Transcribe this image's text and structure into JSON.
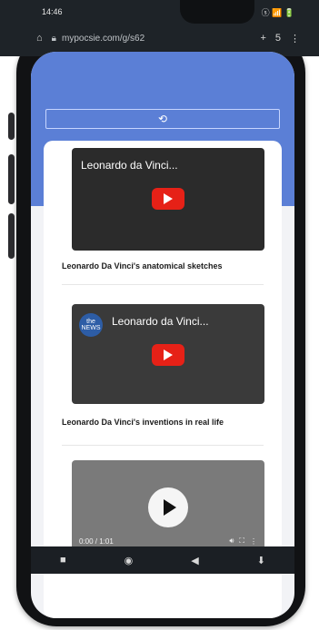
{
  "status": {
    "time": "14:46",
    "left_icons": "ⓔ ⓘ",
    "right_icons": "ⓢ 📶 🔋"
  },
  "browser": {
    "url": "mypocsie.com/g/s62",
    "tabs_count": "5"
  },
  "videos": [
    {
      "title": "Leonardo da Vinci...",
      "caption": "Leonardo Da Vinci's anatomical sketches"
    },
    {
      "title": "Leonardo da Vinci...",
      "caption": "Leonardo Da Vinci's inventions in real life",
      "channel_badge": "the NEWS"
    },
    {
      "duration": "0:00 / 1:01"
    }
  ]
}
